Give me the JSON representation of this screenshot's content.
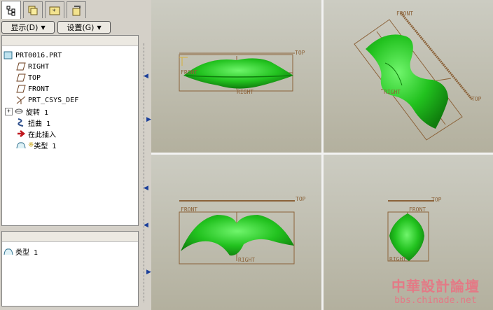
{
  "nav": {
    "tabs": [
      "model-tree",
      "layers",
      "favorites",
      "tools"
    ],
    "show_button": "显示(D)",
    "settings_button": "设置(G)"
  },
  "tree": {
    "items": [
      {
        "label": "PRT0016.PRT",
        "icon": "part-icon"
      },
      {
        "label": "RIGHT",
        "icon": "datum-plane-icon"
      },
      {
        "label": "TOP",
        "icon": "datum-plane-icon"
      },
      {
        "label": "FRONT",
        "icon": "datum-plane-icon"
      },
      {
        "label": "PRT_CSYS_DEF",
        "icon": "csys-icon"
      },
      {
        "label": "旋转 1",
        "icon": "revolve-icon"
      },
      {
        "label": "扭曲 1",
        "icon": "warp-icon"
      },
      {
        "label": "在此插入",
        "icon": "insert-arrow-icon"
      },
      {
        "label": "类型 1",
        "icon": "style-feature-icon"
      }
    ]
  },
  "bottom_panel": {
    "item_label": "类型 1"
  },
  "viewports": {
    "labels": {
      "top": "TOP",
      "front": "FRONT",
      "right": "RIGHT"
    }
  },
  "watermark": {
    "title": "中華設計論壇",
    "url": "bbs.chinade.net"
  },
  "colors": {
    "model_green": "#22c21f",
    "datum_brown": "#8b6239",
    "viewport_bg": "#c4c2b4",
    "watermark": "#e37a86"
  }
}
